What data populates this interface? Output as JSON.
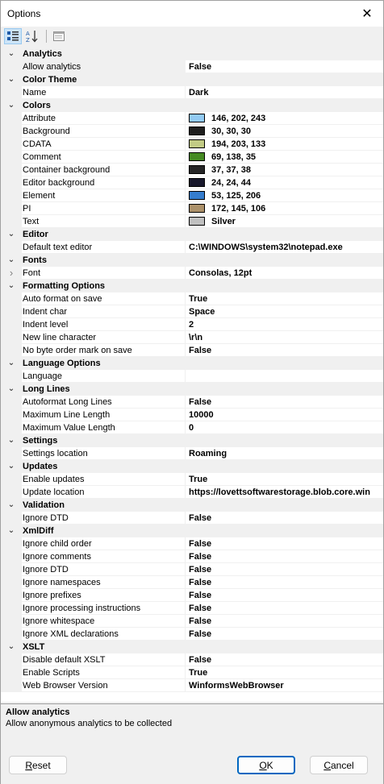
{
  "window": {
    "title": "Options",
    "close_glyph": "✕"
  },
  "toolbar": {
    "buttons": [
      {
        "icon": "categorized-icon"
      },
      {
        "icon": "sort-alphabetical-icon"
      },
      {
        "icon": "property-pages-icon"
      }
    ]
  },
  "grid": {
    "rows": [
      {
        "type": "cat",
        "label": "Analytics"
      },
      {
        "type": "prop",
        "name": "Allow analytics",
        "value": "False",
        "selected": true
      },
      {
        "type": "cat",
        "label": "Color Theme"
      },
      {
        "type": "prop",
        "name": "Name",
        "value": "Dark"
      },
      {
        "type": "cat",
        "label": "Colors"
      },
      {
        "type": "prop",
        "name": "Attribute",
        "value": "146, 202, 243",
        "color": "#92caf3"
      },
      {
        "type": "prop",
        "name": "Background",
        "value": "30, 30, 30",
        "color": "#1e1e1e"
      },
      {
        "type": "prop",
        "name": "CDATA",
        "value": "194, 203, 133",
        "color": "#c2cb85"
      },
      {
        "type": "prop",
        "name": "Comment",
        "value": "69, 138, 35",
        "color": "#458a23"
      },
      {
        "type": "prop",
        "name": "Container background",
        "value": "37, 37, 38",
        "color": "#252526"
      },
      {
        "type": "prop",
        "name": "Editor background",
        "value": "24, 24, 44",
        "color": "#18182c"
      },
      {
        "type": "prop",
        "name": "Element",
        "value": "53, 125, 206",
        "color": "#357dce"
      },
      {
        "type": "prop",
        "name": "PI",
        "value": "172, 145, 106",
        "color": "#ac916a"
      },
      {
        "type": "prop",
        "name": "Text",
        "value": "Silver",
        "color": "#c0c0c0"
      },
      {
        "type": "cat",
        "label": "Editor"
      },
      {
        "type": "prop",
        "name": "Default text editor",
        "value": "C:\\WINDOWS\\system32\\notepad.exe"
      },
      {
        "type": "cat",
        "label": "Fonts"
      },
      {
        "type": "prop",
        "name": "Font",
        "value": "Consolas, 12pt",
        "expandable": true
      },
      {
        "type": "cat",
        "label": "Formatting Options"
      },
      {
        "type": "prop",
        "name": "Auto format on save",
        "value": "True"
      },
      {
        "type": "prop",
        "name": "Indent char",
        "value": "Space"
      },
      {
        "type": "prop",
        "name": "Indent level",
        "value": "2"
      },
      {
        "type": "prop",
        "name": "New line character",
        "value": "\\r\\n"
      },
      {
        "type": "prop",
        "name": "No byte order mark on save",
        "value": "False"
      },
      {
        "type": "cat",
        "label": "Language Options"
      },
      {
        "type": "prop",
        "name": "Language",
        "value": ""
      },
      {
        "type": "cat",
        "label": "Long Lines"
      },
      {
        "type": "prop",
        "name": "Autoformat Long Lines",
        "value": "False"
      },
      {
        "type": "prop",
        "name": "Maximum Line Length",
        "value": "10000"
      },
      {
        "type": "prop",
        "name": "Maximum Value Length",
        "value": "0"
      },
      {
        "type": "cat",
        "label": "Settings"
      },
      {
        "type": "prop",
        "name": "Settings location",
        "value": "Roaming"
      },
      {
        "type": "cat",
        "label": "Updates"
      },
      {
        "type": "prop",
        "name": "Enable updates",
        "value": "True"
      },
      {
        "type": "prop",
        "name": "Update location",
        "value": "https://lovettsoftwarestorage.blob.core.win"
      },
      {
        "type": "cat",
        "label": "Validation"
      },
      {
        "type": "prop",
        "name": "Ignore DTD",
        "value": "False"
      },
      {
        "type": "cat",
        "label": "XmlDiff"
      },
      {
        "type": "prop",
        "name": "Ignore child order",
        "value": "False"
      },
      {
        "type": "prop",
        "name": "Ignore comments",
        "value": "False"
      },
      {
        "type": "prop",
        "name": "Ignore DTD",
        "value": "False"
      },
      {
        "type": "prop",
        "name": "Ignore namespaces",
        "value": "False"
      },
      {
        "type": "prop",
        "name": "Ignore prefixes",
        "value": "False"
      },
      {
        "type": "prop",
        "name": "Ignore processing instructions",
        "value": "False"
      },
      {
        "type": "prop",
        "name": "Ignore whitespace",
        "value": "False"
      },
      {
        "type": "prop",
        "name": "Ignore XML declarations",
        "value": "False"
      },
      {
        "type": "cat",
        "label": "XSLT"
      },
      {
        "type": "prop",
        "name": "Disable default XSLT",
        "value": "False"
      },
      {
        "type": "prop",
        "name": "Enable Scripts",
        "value": "True"
      },
      {
        "type": "prop",
        "name": "Web Browser Version",
        "value": "WinformsWebBrowser"
      }
    ]
  },
  "description": {
    "title": "Allow analytics",
    "text": "Allow anonymous analytics to be collected"
  },
  "buttons": {
    "reset": {
      "label": "Reset",
      "accel": "R"
    },
    "ok": {
      "label": "OK",
      "accel": "O"
    },
    "cancel": {
      "label": "Cancel",
      "accel": "C"
    }
  }
}
